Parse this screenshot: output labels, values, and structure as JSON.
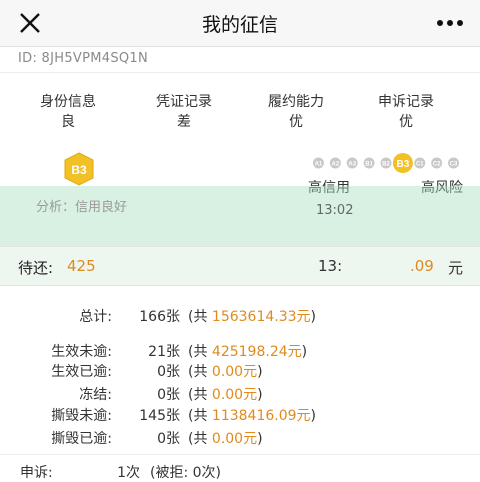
{
  "header": {
    "title": "我的征信",
    "close_icon": "close-icon",
    "more_icon": "more-icon"
  },
  "id_line": {
    "label": "ID: 8JH5VPM4SQ1N"
  },
  "stats": [
    {
      "label": "身份信息",
      "value": "良"
    },
    {
      "label": "凭证记录",
      "value": "差"
    },
    {
      "label": "履约能力",
      "value": "优"
    },
    {
      "label": "申诉记录",
      "value": "优"
    }
  ],
  "badge": {
    "text": "B3",
    "color": "#f2c125"
  },
  "scale": {
    "levels": [
      "A1",
      "A2",
      "A3",
      "B1",
      "B2",
      "B3",
      "C1",
      "C2",
      "C3"
    ],
    "active": "B3",
    "left_label": "高信用",
    "right_label": "高风险"
  },
  "analysis": {
    "text": "分析：信用良好"
  },
  "update": {
    "text": "13:02"
  },
  "pending": {
    "label": "待还:",
    "amount_start": "425",
    "amount_mid": "13:",
    "amount_end": ".09",
    "unit": "元"
  },
  "summary": [
    {
      "key": "总计:",
      "count": "166张",
      "prefix": "(共",
      "amount": "1563614.33元",
      "suffix": ")"
    },
    {
      "key": "生效未逾:",
      "count": "21张",
      "prefix": "(共",
      "amount": "425198.24元",
      "suffix": ")"
    },
    {
      "key": "生效已逾:",
      "count": "0张",
      "prefix": "(共",
      "amount": "0.00元",
      "suffix": ")"
    },
    {
      "key": "冻结:",
      "count": "0张",
      "prefix": "(共",
      "amount": "0.00元",
      "suffix": ")"
    },
    {
      "key": "撕毁未逾:",
      "count": "145张",
      "prefix": "(共",
      "amount": "1138416.09元",
      "suffix": ")"
    },
    {
      "key": "撕毁已逾:",
      "count": "0张",
      "prefix": "(共",
      "amount": "0.00元",
      "suffix": ")"
    }
  ],
  "appeal": {
    "key": "申诉:",
    "count": "1次",
    "detail": "(被拒: 0次)"
  }
}
